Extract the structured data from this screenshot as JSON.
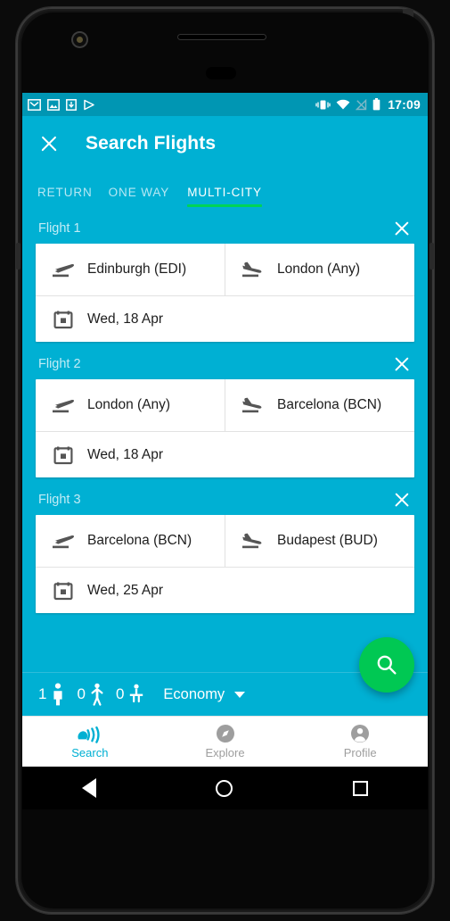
{
  "status_bar": {
    "time": "17:09",
    "left_icons": [
      "gmail-icon",
      "photos-icon",
      "download-icon",
      "play-store-icon"
    ],
    "right_icons": [
      "vibrate-icon",
      "wifi-icon",
      "no-signal-icon",
      "battery-icon"
    ]
  },
  "app_bar": {
    "close_label": "close-icon",
    "title": "Search Flights"
  },
  "tabs": [
    {
      "label": "RETURN",
      "active": false
    },
    {
      "label": "ONE WAY",
      "active": false
    },
    {
      "label": "MULTI-CITY",
      "active": true
    }
  ],
  "flights": [
    {
      "label": "Flight 1",
      "origin": "Edinburgh (EDI)",
      "destination": "London (Any)",
      "date": "Wed, 18 Apr"
    },
    {
      "label": "Flight 2",
      "origin": "London (Any)",
      "destination": "Barcelona (BCN)",
      "date": "Wed, 18 Apr"
    },
    {
      "label": "Flight 3",
      "origin": "Barcelona (BCN)",
      "destination": "Budapest (BUD)",
      "date": "Wed, 25 Apr"
    }
  ],
  "passengers": {
    "adults": "1",
    "children": "0",
    "infants": "0",
    "cabin_class": "Economy"
  },
  "search_button": "search-icon",
  "bottom_nav": [
    {
      "label": "Search",
      "icon": "skyscanner-logo-icon",
      "active": true
    },
    {
      "label": "Explore",
      "icon": "compass-icon",
      "active": false
    },
    {
      "label": "Profile",
      "icon": "person-icon",
      "active": false
    }
  ],
  "colors": {
    "primary": "#00b0d3",
    "status_bar": "#0096b3",
    "accent_green": "#00d455",
    "fab_green": "#00c853",
    "muted_text": "#9e9e9e"
  }
}
